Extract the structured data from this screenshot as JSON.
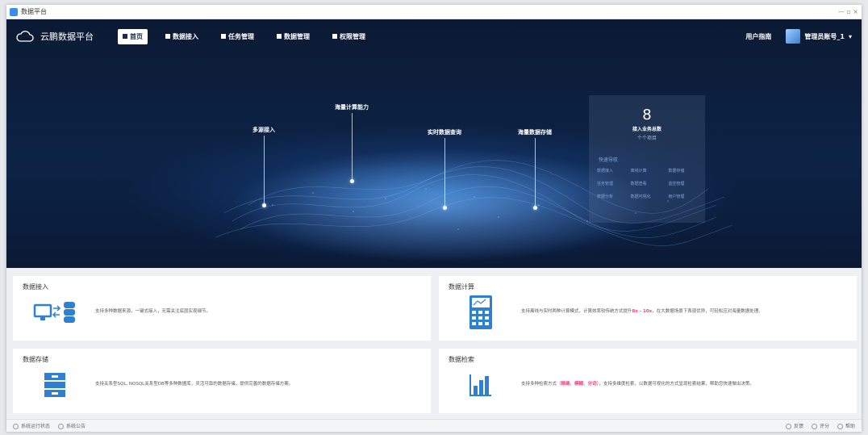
{
  "window": {
    "title": "数据平台",
    "controls": "— ▫ ×"
  },
  "navbar": {
    "brand": "云鹏数据平台",
    "items": [
      {
        "label": "首页",
        "active": true
      },
      {
        "label": "数据接入",
        "active": false
      },
      {
        "label": "任务管理",
        "active": false
      },
      {
        "label": "数据管理",
        "active": false
      },
      {
        "label": "权限管理",
        "active": false
      }
    ],
    "right_link": "用户指南",
    "user": "管理员账号_1"
  },
  "hero": {
    "features": [
      "多源接入",
      "海量计算能力",
      "实时数据查询",
      "海量数据存储"
    ],
    "stats": {
      "count": "8",
      "label": "接入业务总数",
      "sub": "个个项目",
      "section_title": "快速导航",
      "tags": [
        "数据接入",
        "离线计算",
        "数据存储",
        "任务管理",
        "数据查看",
        "监控管理",
        "数据分析",
        "数据可视化",
        "用户管理"
      ]
    }
  },
  "cards": [
    {
      "title": "数据接入",
      "icon": "data-ingest-icon",
      "desc": "支持多种数据来源，一键式接入，无需关注底层实现细节。"
    },
    {
      "title": "数据计算",
      "icon": "calculator-icon",
      "desc_pre": "支持离线与实时两种计算模式，计算效率较传统方式提升",
      "desc_hl": "8x - 10x",
      "desc_post": "，在大数据场景下表现优异，可轻松应对海量数据处理。"
    },
    {
      "title": "数据存储",
      "icon": "storage-icon",
      "desc": "支持关系型SQL, NOSQL关系型DB等多种数据库，灵活可靠的数据存储，提供完善的数据存储方案。"
    },
    {
      "title": "数据检索",
      "icon": "bar-chart-icon",
      "desc_pre": "支持多种检索方式（",
      "desc_hl1": "精确",
      "desc_mid1": "、",
      "desc_hl2": "模糊",
      "desc_mid2": "、",
      "desc_hl3": "分词",
      "desc_post": "），支持多维度检索，以数据可视化的方式呈现检索结果，帮助您快速做出决策。"
    }
  ],
  "statusbar": {
    "left": [
      "系统运行状态",
      "系统公告"
    ],
    "right": [
      "反馈",
      "评分",
      "帮助"
    ]
  },
  "colors": {
    "accent": "#2f80d1",
    "highlight": "#e8467c",
    "hero_bg": "#0b1a33"
  }
}
